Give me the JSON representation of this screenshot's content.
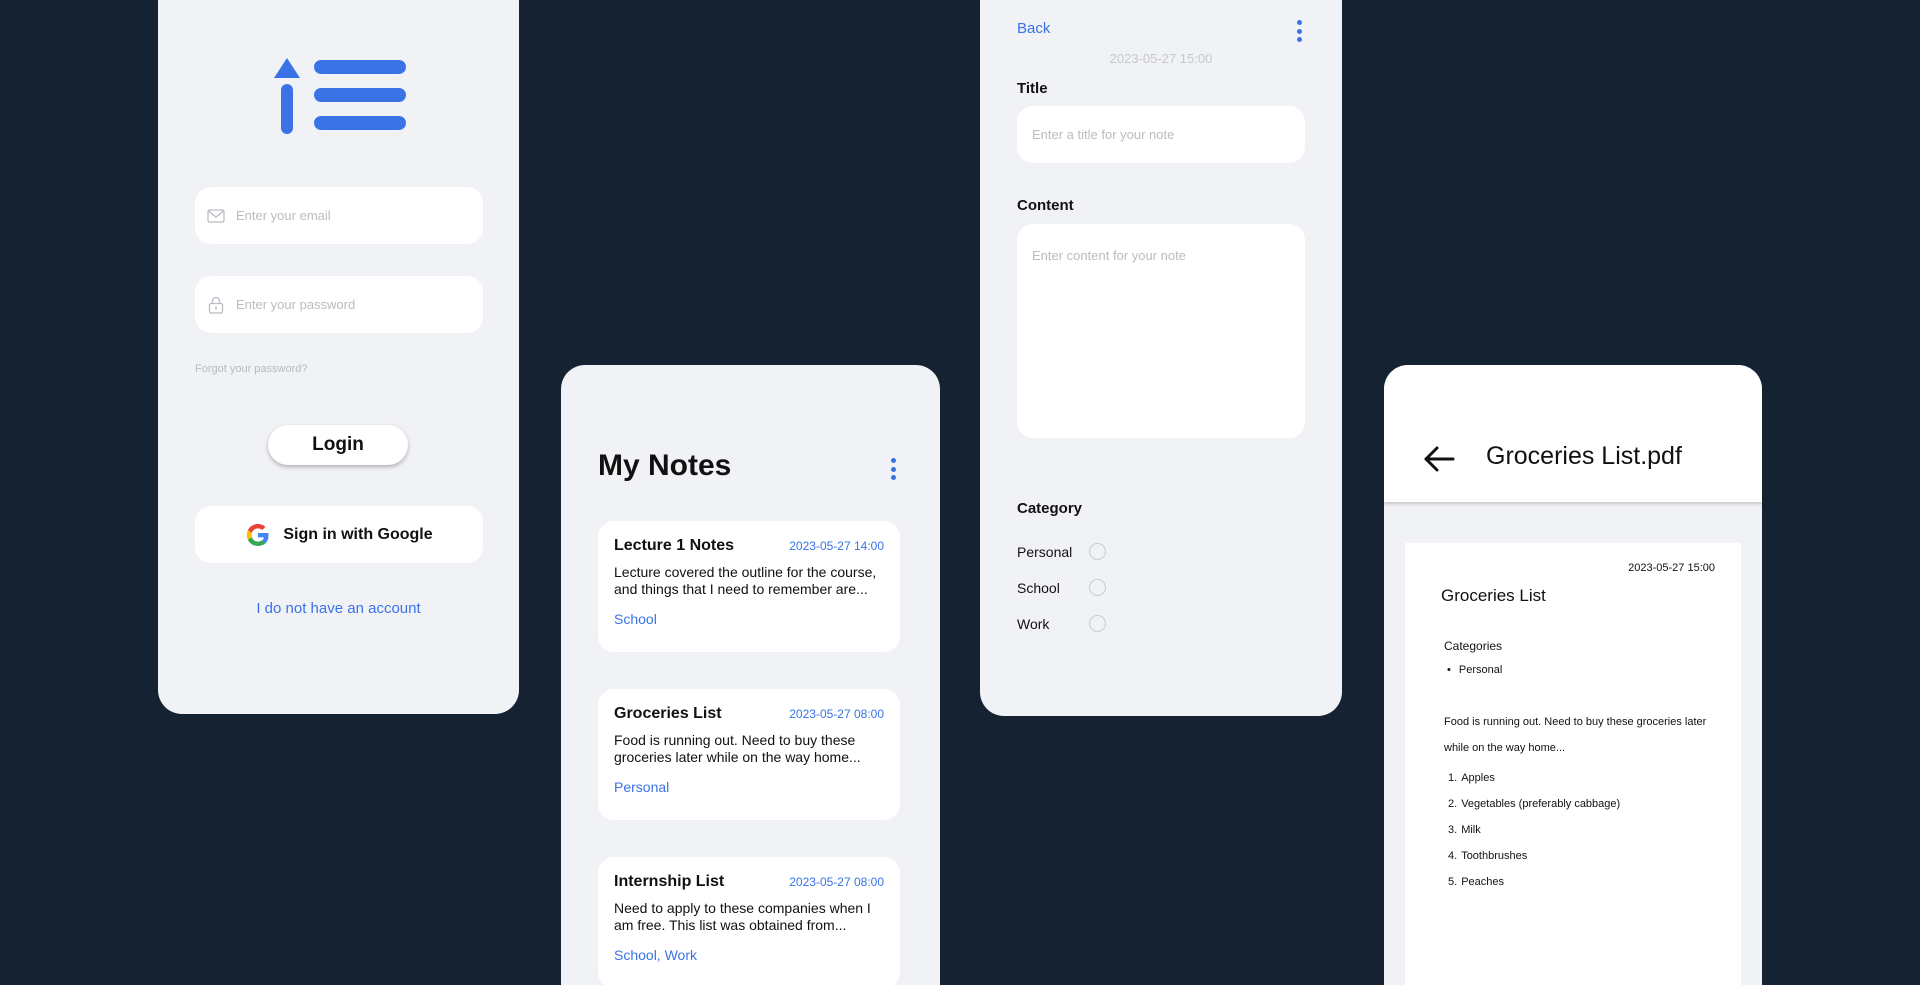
{
  "colors": {
    "background": "#142232",
    "panel": "#f1f2f6",
    "accent": "#3a73e6"
  },
  "login": {
    "email_placeholder": "Enter your email",
    "password_placeholder": "Enter your password",
    "forgot_label": "Forgot your password?",
    "login_label": "Login",
    "google_label": "Sign in with Google",
    "no_account_label": "I do not have an account"
  },
  "notes": {
    "title": "My Notes",
    "items": [
      {
        "title": "Lecture 1 Notes",
        "date": "2023-05-27 14:00",
        "body": "Lecture covered the outline for the course, and things that I need to remember are...",
        "category": "School"
      },
      {
        "title": "Groceries List",
        "date": "2023-05-27 08:00",
        "body": "Food is running out. Need to buy these groceries later while on the way home...",
        "category": "Personal"
      },
      {
        "title": "Internship List",
        "date": "2023-05-27 08:00",
        "body": "Need to apply to these companies when I am free. This list was obtained from...",
        "category": "School, Work"
      }
    ]
  },
  "editor": {
    "back_label": "Back",
    "date": "2023-05-27 15:00",
    "title_label": "Title",
    "title_placeholder": "Enter a title for your note",
    "content_label": "Content",
    "content_placeholder": "Enter content for your note",
    "category_label": "Category",
    "categories": [
      "Personal",
      "School",
      "Work"
    ]
  },
  "pdf": {
    "file_name": "Groceries List.pdf",
    "page": {
      "date": "2023-05-27 15:00",
      "title": "Groceries List",
      "categories_label": "Categories",
      "category": "Personal",
      "body": "Food is running out. Need to buy these groceries later while on the way home...",
      "items": [
        "Apples",
        "Vegetables (preferably cabbage)",
        "Milk",
        "Toothbrushes",
        "Peaches"
      ]
    }
  },
  "icons": {
    "logo": "sort-list-icon",
    "email": "mail-icon",
    "password": "lock-icon",
    "google": "google-logo-icon",
    "menu": "kebab-menu-icon",
    "back": "arrow-left-icon",
    "radio": "radio-unchecked-icon"
  }
}
